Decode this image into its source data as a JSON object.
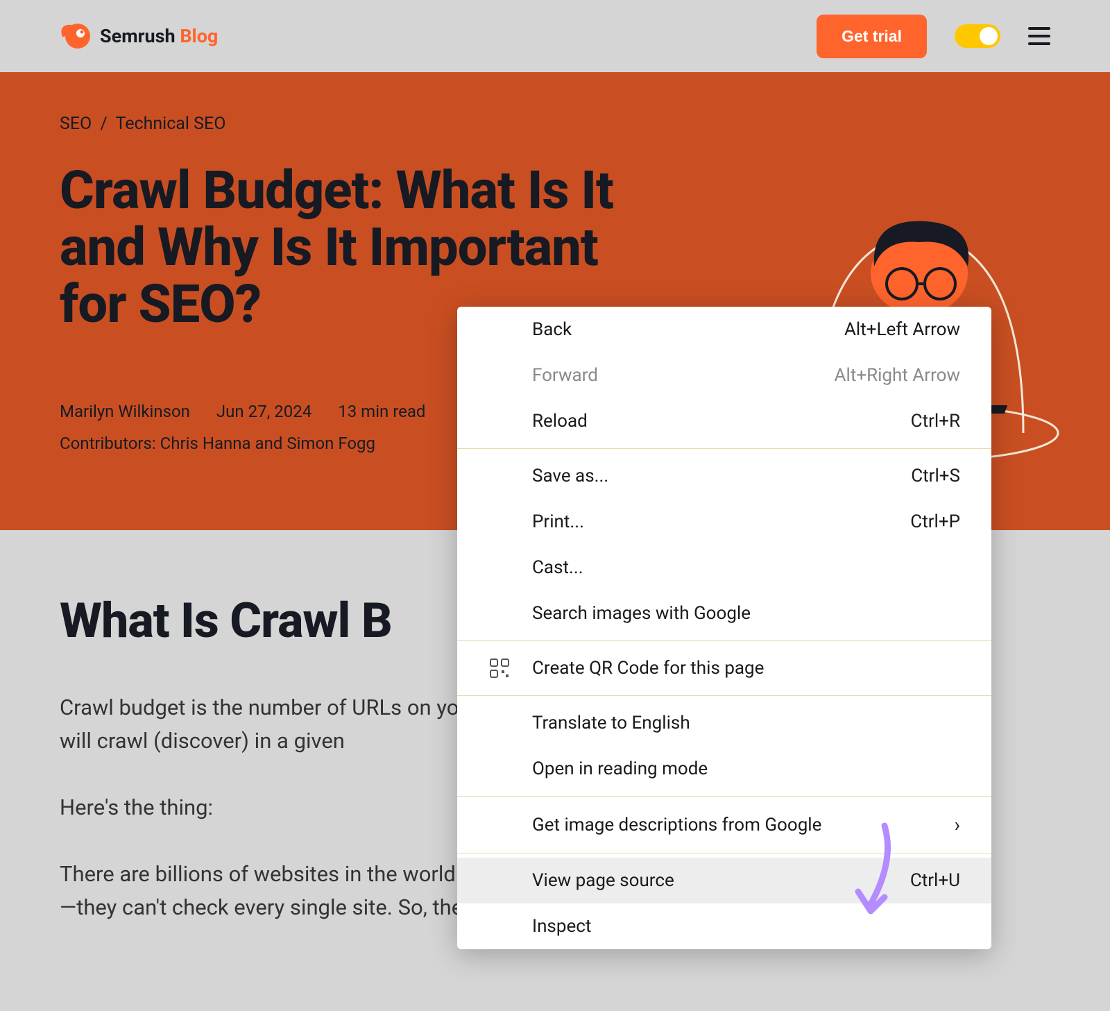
{
  "header": {
    "brand_name": "Semrush",
    "brand_suffix": "Blog",
    "cta_label": "Get trial"
  },
  "breadcrumb": {
    "items": [
      "SEO",
      "Technical SEO"
    ],
    "separator": "/"
  },
  "hero": {
    "title": "Crawl Budget: What Is It and Why Is It Important for SEO?",
    "author": "Marilyn Wilkinson",
    "date": "Jun 27, 2024",
    "read_time": "13 min read",
    "contributors": "Contributors: Chris Hanna and Simon Fogg"
  },
  "content": {
    "section_title": "What Is Crawl B",
    "para1": "Crawl budget is the number of URLs on your website that search engines like Google will crawl (discover) in a given",
    "para2": "Here's the thing:",
    "para3": "There are billions of websites in the world. And search engines have limited resources—they can't check every single site. So, they have to prioritize what and when to crawl."
  },
  "context_menu": {
    "items": [
      {
        "label": "Back",
        "shortcut": "Alt+Left Arrow",
        "enabled": true
      },
      {
        "label": "Forward",
        "shortcut": "Alt+Right Arrow",
        "enabled": false
      },
      {
        "label": "Reload",
        "shortcut": "Ctrl+R",
        "enabled": true
      }
    ],
    "items2": [
      {
        "label": "Save as...",
        "shortcut": "Ctrl+S"
      },
      {
        "label": "Print...",
        "shortcut": "Ctrl+P"
      },
      {
        "label": "Cast...",
        "shortcut": ""
      },
      {
        "label": "Search images with Google",
        "shortcut": ""
      }
    ],
    "items3": [
      {
        "label": "Create QR Code for this page",
        "icon": "qr"
      }
    ],
    "items4": [
      {
        "label": "Translate to English"
      },
      {
        "label": "Open in reading mode"
      }
    ],
    "items5": [
      {
        "label": "Get image descriptions from Google",
        "submenu": true
      }
    ],
    "items6": [
      {
        "label": "View page source",
        "shortcut": "Ctrl+U",
        "highlighted": true
      },
      {
        "label": "Inspect",
        "shortcut": ""
      }
    ]
  }
}
